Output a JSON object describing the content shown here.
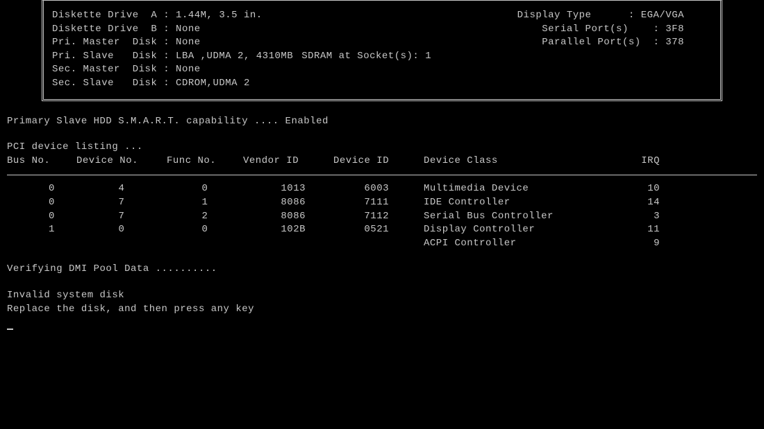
{
  "system_info": {
    "left": [
      {
        "label": "Diskette Drive  A",
        "value": "1.44M, 3.5 in."
      },
      {
        "label": "Diskette Drive  B",
        "value": "None"
      },
      {
        "label": "Pri. Master  Disk",
        "value": "None"
      },
      {
        "label": "Pri. Slave   Disk",
        "value": "LBA ,UDMA 2, 4310MB"
      },
      {
        "label": "Sec. Master  Disk",
        "value": "None"
      },
      {
        "label": "Sec. Slave   Disk",
        "value": "CDROM,UDMA 2"
      }
    ],
    "right": [
      {
        "label": "Display Type      ",
        "value": "EGA/VGA"
      },
      {
        "label": "Serial Port(s)    ",
        "value": "3F8"
      },
      {
        "label": "Parallel Port(s)  ",
        "value": "378"
      },
      {
        "label": "SDRAM at Socket(s)",
        "value": "1"
      }
    ]
  },
  "smart_line": "Primary Slave    HDD S.M.A.R.T. capability .... Enabled",
  "pci_title": "PCI device listing ...",
  "pci_headers": {
    "bus": "Bus No.",
    "dev": "Device No.",
    "func": "Func No.",
    "vendor": "Vendor ID",
    "device": "Device ID",
    "class": "Device Class",
    "irq": "IRQ"
  },
  "pci_rows": [
    {
      "bus": "0",
      "dev": "4",
      "func": "0",
      "vendor": "1013",
      "device": "6003",
      "class": "Multimedia Device",
      "irq": "10"
    },
    {
      "bus": "0",
      "dev": "7",
      "func": "1",
      "vendor": "8086",
      "device": "7111",
      "class": "IDE Controller",
      "irq": "14"
    },
    {
      "bus": "0",
      "dev": "7",
      "func": "2",
      "vendor": "8086",
      "device": "7112",
      "class": "Serial Bus Controller",
      "irq": "3"
    },
    {
      "bus": "1",
      "dev": "0",
      "func": "0",
      "vendor": "102B",
      "device": "0521",
      "class": "Display Controller",
      "irq": "11"
    },
    {
      "bus": "",
      "dev": "",
      "func": "",
      "vendor": "",
      "device": "",
      "class": "ACPI Controller",
      "irq": "9"
    }
  ],
  "dmi_line": "Verifying DMI Pool Data ..........",
  "error_line1": "Invalid system disk",
  "error_line2": "Replace the disk, and then press any key"
}
